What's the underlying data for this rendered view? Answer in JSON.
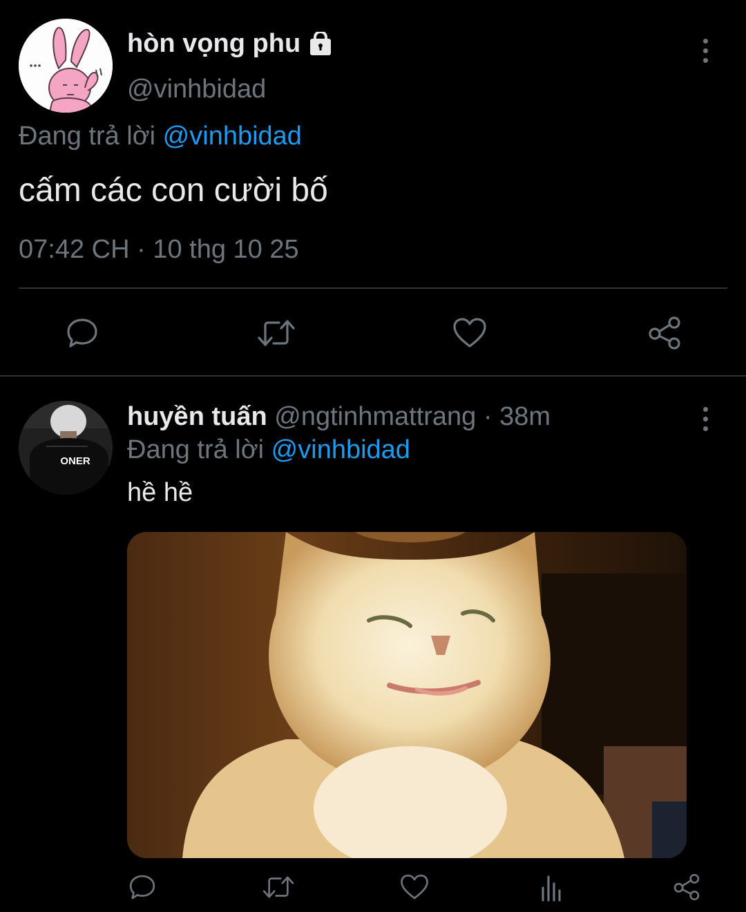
{
  "main_tweet": {
    "display_name": "hòn vọng phu",
    "handle": "@vinhbidad",
    "reply_prefix": "Đang trả lời",
    "reply_to": "@vinhbidad",
    "text": "cấm các con cười bố",
    "timestamp": "07:42 CH · 10 thg 10 25",
    "icons": {
      "locked": "lock-icon",
      "more": "more-vertical-icon",
      "actions": [
        "reply-icon",
        "retweet-icon",
        "like-icon",
        "share-icon"
      ]
    }
  },
  "reply_tweet": {
    "display_name": "huyền tuấn",
    "handle": "@ngtinhmattrang",
    "time_ago": "· 38m",
    "reply_prefix": "Đang trả lời",
    "reply_to": "@vinhbidad",
    "text": "hề hề",
    "avatar_jersey_text": "ONER",
    "icons": {
      "more": "more-vertical-icon",
      "actions": [
        "reply-icon",
        "retweet-icon",
        "like-icon",
        "analytics-icon",
        "share-icon"
      ]
    }
  },
  "colors": {
    "background": "#000000",
    "text": "#e7e9ea",
    "muted": "#6e767d",
    "link": "#1d9bf0",
    "divider": "#2f3336"
  }
}
